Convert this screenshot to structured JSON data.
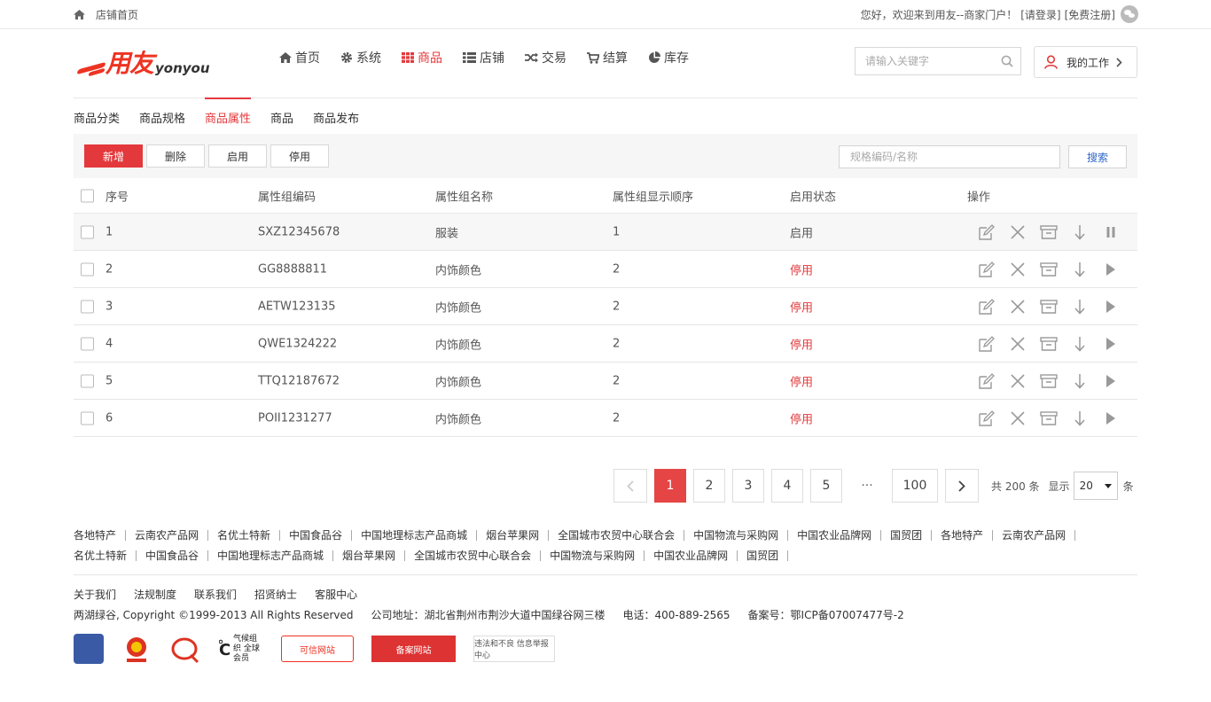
{
  "topbar": {
    "home_label": "店铺首页",
    "welcome": "您好，欢迎来到用友--商家门户！",
    "login": "[请登录]",
    "register": "[免费注册]"
  },
  "logo": {
    "cn": "用友",
    "en": "yonyou"
  },
  "nav": {
    "items": [
      {
        "label": "首页",
        "icon": "home-icon"
      },
      {
        "label": "系统",
        "icon": "gear-icon"
      },
      {
        "label": "商品",
        "icon": "grid-icon",
        "active": true
      },
      {
        "label": "店铺",
        "icon": "list-icon"
      },
      {
        "label": "交易",
        "icon": "shuffle-icon"
      },
      {
        "label": "结算",
        "icon": "cart-icon"
      },
      {
        "label": "库存",
        "icon": "pie-icon"
      }
    ],
    "active_color": "#e3393c"
  },
  "search": {
    "placeholder": "请输入关键字"
  },
  "mywork": {
    "label": "我的工作"
  },
  "subnav": {
    "tabs": [
      "商品分类",
      "商品规格",
      "商品属性",
      "商品",
      "商品发布"
    ],
    "active_index": 2
  },
  "toolbar": {
    "add": "新增",
    "delete": "删除",
    "enable": "启用",
    "disable": "停用",
    "keyword_placeholder": "规格编码/名称",
    "search": "搜索"
  },
  "table": {
    "headers": [
      "序号",
      "属性组编码",
      "属性组名称",
      "属性组显示顺序",
      "启用状态",
      "操作"
    ],
    "rows": [
      {
        "no": "1",
        "code": "SXZ12345678",
        "name": "服装",
        "order": "1",
        "status": "启用"
      },
      {
        "no": "2",
        "code": "GG8888811",
        "name": "内饰颜色",
        "order": "2",
        "status": "停用"
      },
      {
        "no": "3",
        "code": "AETW123135",
        "name": "内饰颜色",
        "order": "2",
        "status": "停用"
      },
      {
        "no": "4",
        "code": "QWE1324222",
        "name": "内饰颜色",
        "order": "2",
        "status": "停用"
      },
      {
        "no": "5",
        "code": "TTQ12187672",
        "name": "内饰颜色",
        "order": "2",
        "status": "停用"
      },
      {
        "no": "6",
        "code": "POII1231277",
        "name": "内饰颜色",
        "order": "2",
        "status": "停用"
      }
    ]
  },
  "pager": {
    "pages": [
      "1",
      "2",
      "3",
      "4",
      "5"
    ],
    "ellipsis": "···",
    "last": "100",
    "total": "共 200 条",
    "show": "显示",
    "size": "20",
    "unit": "条"
  },
  "links": {
    "items": [
      "各地特产",
      "云南农产品网",
      "名优土特新",
      "中国食品谷",
      "中国地理标志产品商城",
      "烟台苹果网",
      "全国城市农贸中心联合会",
      "中国物流与采购网",
      "中国农业品牌网",
      "国贸团",
      "各地特产",
      "云南农产品网",
      "名优土特新",
      "中国食品谷",
      "中国地理标志产品商城",
      "烟台苹果网",
      "全国城市农贸中心联合会",
      "中国物流与采购网",
      "中国农业品牌网",
      "国贸团"
    ]
  },
  "footer": {
    "links": [
      "关于我们",
      "法规制度",
      "联系我们",
      "招贤纳士",
      "客服中心"
    ],
    "copyright": "两湖绿谷, Copyright ©1999-2013 All Rights Reserved",
    "address": "公司地址：湖北省荆州市荆沙大道中国绿谷网三楼",
    "phone": "电话：400-889-2565",
    "icp": "备案号：鄂ICP备07007477号-2",
    "badges": {
      "climate": "气候组织 全球会员",
      "trusted": "可信网站",
      "record": "备案网站",
      "report": "违法和不良 信息举报中心"
    }
  }
}
